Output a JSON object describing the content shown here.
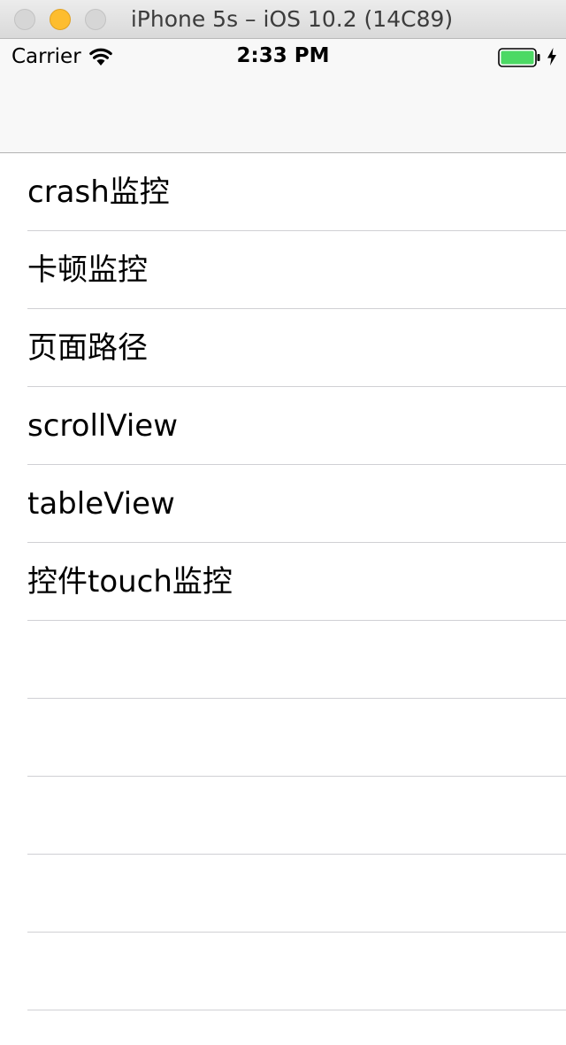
{
  "window": {
    "title": "iPhone 5s – iOS 10.2 (14C89)"
  },
  "status_bar": {
    "carrier": "Carrier",
    "time": "2:33 PM",
    "battery_color": "#4cd964",
    "icons": [
      "wifi-icon",
      "battery-icon",
      "charging-icon"
    ]
  },
  "table": {
    "rows": [
      {
        "label": "crash监控"
      },
      {
        "label": "卡顿监控"
      },
      {
        "label": "页面路径"
      },
      {
        "label": "scrollView"
      },
      {
        "label": "tableView"
      },
      {
        "label": "控件touch监控"
      },
      {
        "label": ""
      },
      {
        "label": ""
      },
      {
        "label": ""
      },
      {
        "label": ""
      },
      {
        "label": ""
      },
      {
        "label": ""
      }
    ]
  }
}
